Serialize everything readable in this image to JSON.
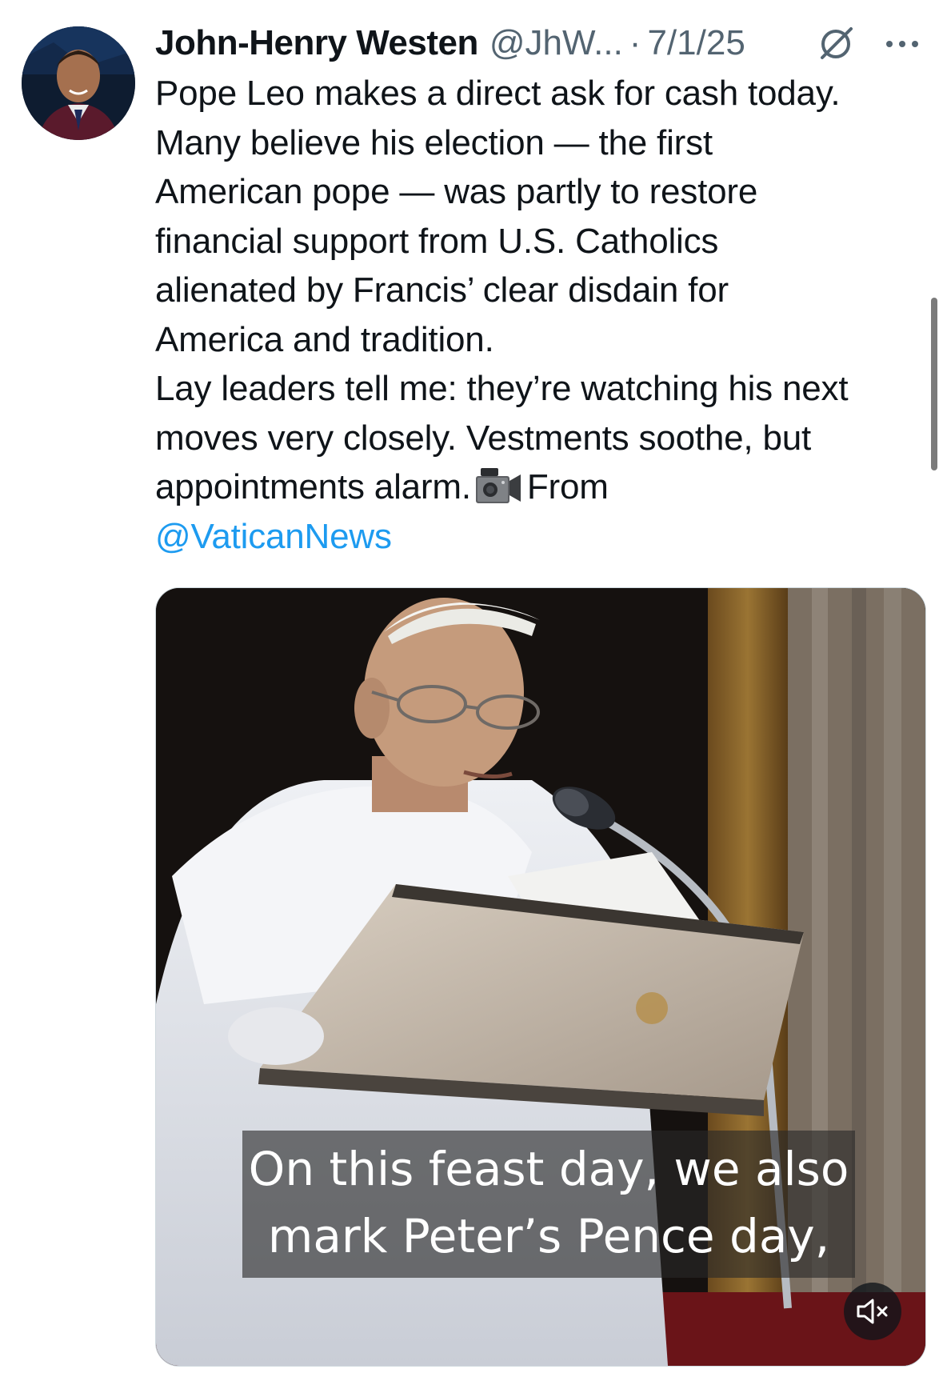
{
  "author": {
    "name": "John-Henry Westen",
    "handle": "@JhW...",
    "separator": "·",
    "date": "7/1/25"
  },
  "tweet": {
    "lines": [
      "Pope Leo makes a direct ask for cash today.",
      "Many believe his election — the first",
      "American pope — was partly to restore",
      "financial support from U.S. Catholics",
      "alienated by Francis’ clear disdain for",
      "America and tradition.",
      "Lay leaders tell me: they’re watching his next",
      "moves very closely. Vestments soothe, but",
      "appointments alarm."
    ],
    "after_emoji": "From",
    "mention": "@VaticanNews",
    "emoji_icon": "video-camera-icon"
  },
  "video": {
    "subtitle_line1": "On this feast day, we also",
    "subtitle_line2": "mark Peter’s Pence day,",
    "muted": true
  },
  "icons": {
    "grok": "grok-icon",
    "more": "more-options-icon",
    "mute": "volume-muted-icon"
  },
  "colors": {
    "text": "#0f1419",
    "secondary": "#536471",
    "link": "#1d9bf0"
  }
}
